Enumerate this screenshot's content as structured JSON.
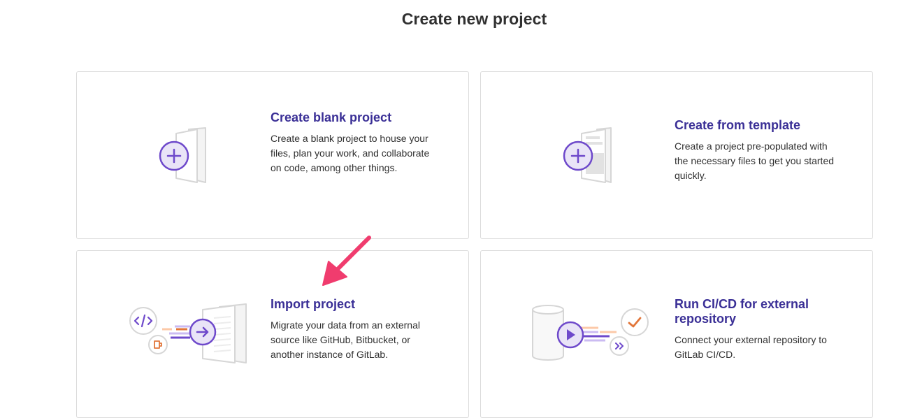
{
  "page": {
    "title": "Create new project"
  },
  "cards": [
    {
      "title": "Create blank project",
      "description": "Create a blank project to house your files, plan your work, and collaborate on code, among other things.",
      "icon": "blank-project-illustration-icon"
    },
    {
      "title": "Create from template",
      "description": "Create a project pre-populated with the necessary files to get you started quickly.",
      "icon": "template-project-illustration-icon"
    },
    {
      "title": "Import project",
      "description": "Migrate your data from an external source like GitHub, Bitbucket, or another instance of GitLab.",
      "icon": "import-project-illustration-icon"
    },
    {
      "title": "Run CI/CD for external repository",
      "description": "Connect your external repository to GitLab CI/CD.",
      "icon": "cicd-project-illustration-icon"
    }
  ],
  "colors": {
    "accent": "#3a2f96",
    "purple": "#6e49cb",
    "orange": "#e2763a",
    "annotation": "#f03c6e"
  }
}
